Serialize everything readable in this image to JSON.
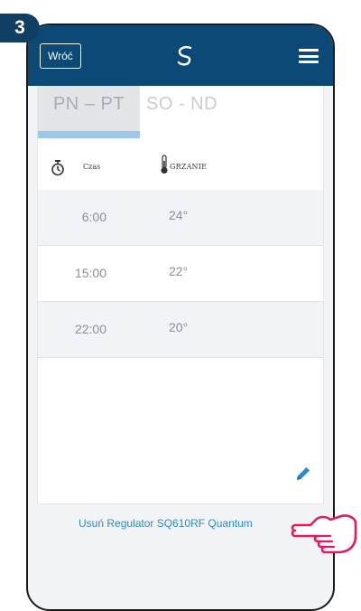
{
  "badge": {
    "step": "3"
  },
  "header": {
    "back_label": "Wróć",
    "logo_icon": "salus-logo-icon",
    "menu_icon": "hamburger-menu-icon",
    "background": "#0d4976"
  },
  "tabs": [
    {
      "label": "PN – PT",
      "active": true
    },
    {
      "label": "SO - ND",
      "active": false
    }
  ],
  "columns": {
    "time_label": "Czas",
    "temp_label": "GRZANIE"
  },
  "schedule": [
    {
      "time": "6:00",
      "temp": "24°"
    },
    {
      "time": "15:00",
      "temp": "22°"
    },
    {
      "time": "22:00",
      "temp": "20°"
    }
  ],
  "edit_icon": "pencil-edit-icon",
  "remove_link": "Usuń Regulator SQ610RF Quantum",
  "colors": {
    "accent": "#2b8bd0",
    "tab_indicator": "#9cc8ea",
    "hand": "#e5195e"
  }
}
